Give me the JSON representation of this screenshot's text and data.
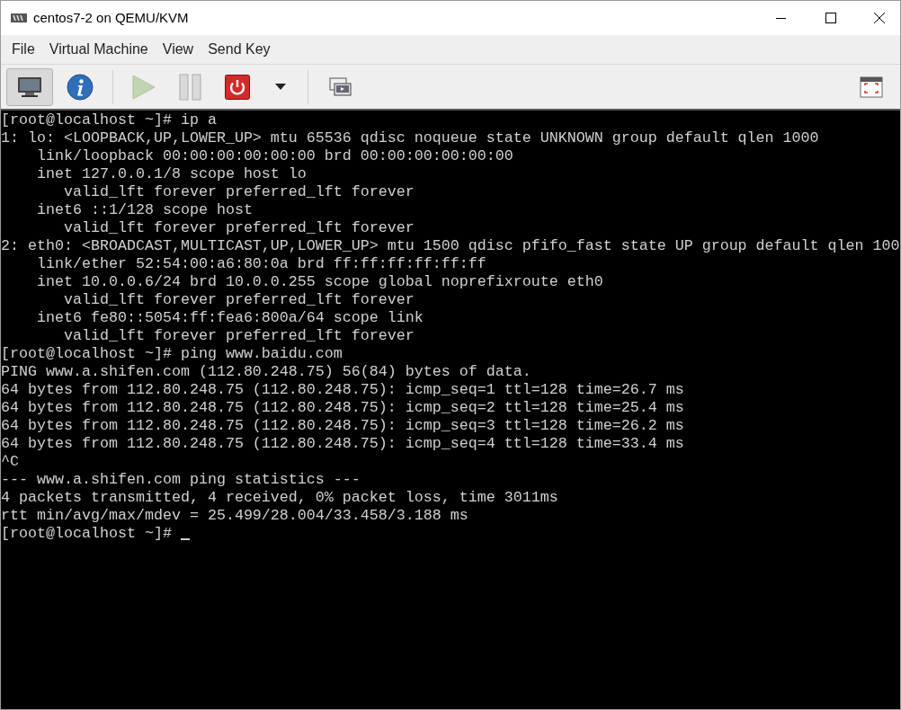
{
  "window": {
    "title": "centos7-2 on QEMU/KVM"
  },
  "menu": [
    "File",
    "Virtual Machine",
    "View",
    "Send Key"
  ],
  "toolbar": {
    "views": [
      {
        "kind": "console",
        "selected": true
      },
      {
        "kind": "details",
        "selected": false
      }
    ],
    "actions": [
      {
        "kind": "run",
        "disabled": true
      },
      {
        "kind": "pause",
        "disabled": true
      },
      {
        "kind": "shutdown",
        "disabled": false
      },
      {
        "kind": "dropdown",
        "disabled": false
      }
    ]
  },
  "terminal": {
    "lines": [
      "[root@localhost ~]# ip a",
      "1: lo: <LOOPBACK,UP,LOWER_UP> mtu 65536 qdisc noqueue state UNKNOWN group default qlen 1000",
      "    link/loopback 00:00:00:00:00:00 brd 00:00:00:00:00:00",
      "    inet 127.0.0.1/8 scope host lo",
      "       valid_lft forever preferred_lft forever",
      "    inet6 ::1/128 scope host",
      "       valid_lft forever preferred_lft forever",
      "2: eth0: <BROADCAST,MULTICAST,UP,LOWER_UP> mtu 1500 qdisc pfifo_fast state UP group default qlen 100",
      "    link/ether 52:54:00:a6:80:0a brd ff:ff:ff:ff:ff:ff",
      "    inet 10.0.0.6/24 brd 10.0.0.255 scope global noprefixroute eth0",
      "       valid_lft forever preferred_lft forever",
      "    inet6 fe80::5054:ff:fea6:800a/64 scope link",
      "       valid_lft forever preferred_lft forever",
      "[root@localhost ~]# ping www.baidu.com",
      "PING www.a.shifen.com (112.80.248.75) 56(84) bytes of data.",
      "64 bytes from 112.80.248.75 (112.80.248.75): icmp_seq=1 ttl=128 time=26.7 ms",
      "64 bytes from 112.80.248.75 (112.80.248.75): icmp_seq=2 ttl=128 time=25.4 ms",
      "64 bytes from 112.80.248.75 (112.80.248.75): icmp_seq=3 ttl=128 time=26.2 ms",
      "64 bytes from 112.80.248.75 (112.80.248.75): icmp_seq=4 ttl=128 time=33.4 ms",
      "^C",
      "--- www.a.shifen.com ping statistics ---",
      "4 packets transmitted, 4 received, 0% packet loss, time 3011ms",
      "rtt min/avg/max/mdev = 25.499/28.004/33.458/3.188 ms"
    ],
    "prompt": "[root@localhost ~]#"
  }
}
